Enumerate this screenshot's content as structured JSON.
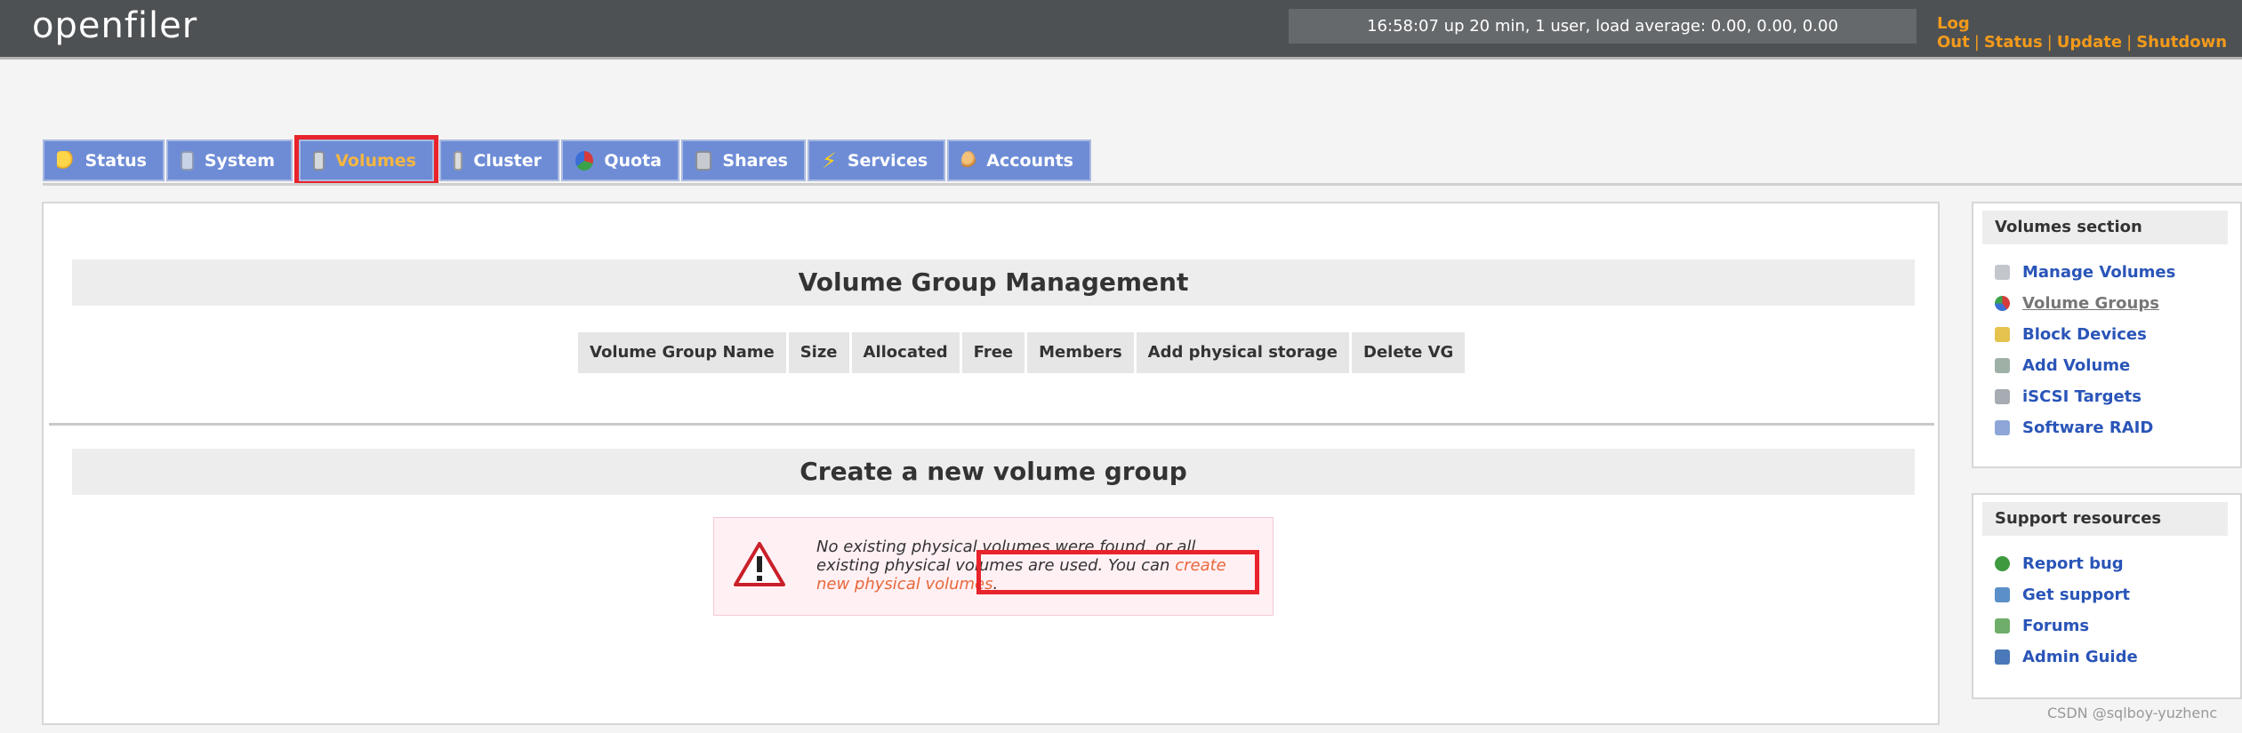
{
  "header": {
    "logo": "openfiler",
    "uptime": "16:58:07 up 20 min, 1 user, load average: 0.00, 0.00, 0.00",
    "links": [
      "Log Out",
      "Status",
      "Update",
      "Shutdown"
    ]
  },
  "tabs": [
    {
      "label": "Status",
      "icon": "sun-icon",
      "active": false
    },
    {
      "label": "System",
      "icon": "monitor-icon",
      "active": false
    },
    {
      "label": "Volumes",
      "icon": "disk-icon",
      "active": true
    },
    {
      "label": "Cluster",
      "icon": "cluster-icon",
      "active": false
    },
    {
      "label": "Quota",
      "icon": "pie-icon",
      "active": false
    },
    {
      "label": "Shares",
      "icon": "drive-icon",
      "active": false
    },
    {
      "label": "Services",
      "icon": "lightning-icon",
      "active": false
    },
    {
      "label": "Accounts",
      "icon": "users-icon",
      "active": false
    }
  ],
  "main": {
    "vg_title": "Volume Group Management",
    "vg_columns": [
      "Volume Group Name",
      "Size",
      "Allocated",
      "Free",
      "Members",
      "Add physical storage",
      "Delete VG"
    ],
    "create_title": "Create a new volume group",
    "alert": {
      "text_prefix": "No existing physical volumes were found, or all existing physical volumes are used. You can ",
      "link": "create new physical volumes",
      "text_suffix": "."
    }
  },
  "sidebar": {
    "volumes_title": "Volumes section",
    "volumes_items": [
      {
        "label": "Manage Volumes",
        "icon": "volumes-icon",
        "current": false
      },
      {
        "label": "Volume Groups",
        "icon": "volume-groups-icon",
        "current": true
      },
      {
        "label": "Block Devices",
        "icon": "block-devices-icon",
        "current": false
      },
      {
        "label": "Add Volume",
        "icon": "add-volume-icon",
        "current": false
      },
      {
        "label": "iSCSI Targets",
        "icon": "iscsi-icon",
        "current": false
      },
      {
        "label": "Software RAID",
        "icon": "raid-icon",
        "current": false
      }
    ],
    "support_title": "Support resources",
    "support_items": [
      {
        "label": "Report bug",
        "icon": "bug-icon"
      },
      {
        "label": "Get support",
        "icon": "support-icon"
      },
      {
        "label": "Forums",
        "icon": "forums-icon"
      },
      {
        "label": "Admin Guide",
        "icon": "book-icon"
      }
    ]
  },
  "watermark": "CSDN @sqlboy-yuzhenc",
  "colors": {
    "header_bg": "#4d5154",
    "tab_bg": "#6e8cd6",
    "tab_active_text": "#f5b642",
    "link": "#2a55b8",
    "top_link": "#f39a1a",
    "highlight": "#e8232b"
  }
}
